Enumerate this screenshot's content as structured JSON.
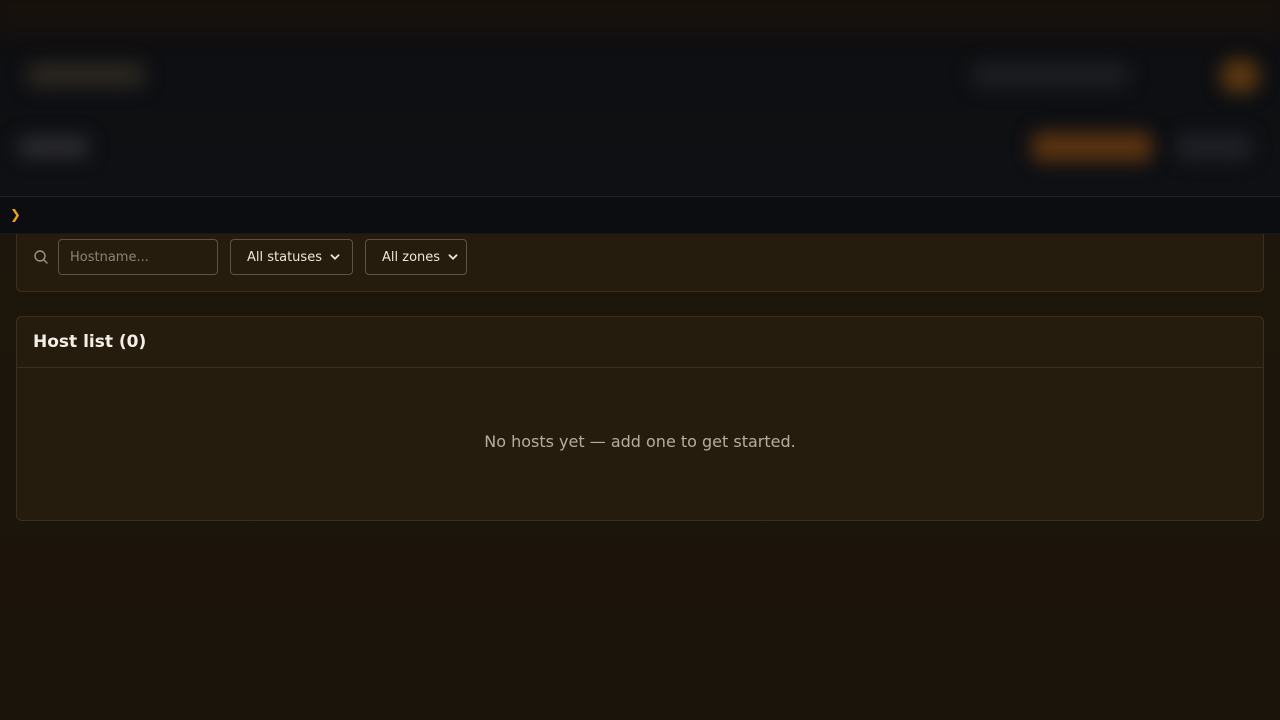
{
  "prompt": {
    "caret": "❯"
  },
  "filters": {
    "search_placeholder": "Hostname...",
    "status_select": {
      "selected": "All statuses"
    },
    "zone_select": {
      "selected": "All zones"
    }
  },
  "host_list": {
    "title": "Host list (0)",
    "empty_message": "No hosts yet — add one to get started."
  },
  "icons": {
    "search": "search-icon",
    "chevron": "chevron-down-icon"
  },
  "colors": {
    "accent": "#f0a020",
    "card_background": "#261c0e",
    "card_border": "#3d301b"
  }
}
